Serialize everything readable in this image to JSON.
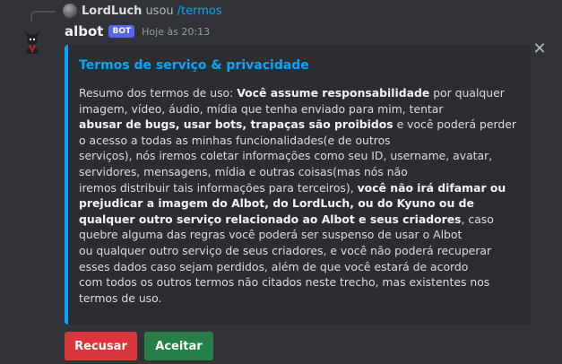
{
  "reply": {
    "author": "LordLuch",
    "verb": "usou",
    "command": "/termos"
  },
  "message": {
    "author": "albot",
    "badge": "BOT",
    "timestamp": "Hoje às 20:13"
  },
  "embed": {
    "color": "#00a8fc",
    "title": "Termos de serviço & privacidade",
    "segments": [
      {
        "text": "Resumo dos termos de uso: ",
        "bold": false
      },
      {
        "text": "Você assume responsabilidade",
        "bold": true
      },
      {
        "text": " por qualquer imagem, vídeo, áudio, mídia que tenha enviado para mim, tentar",
        "bold": false
      },
      {
        "br": true
      },
      {
        "text": "abusar de bugs, usar bots, trapaças são proibidos",
        "bold": true
      },
      {
        "text": " e você poderá perder o acesso a todas as minhas funcionalidades(e de outros",
        "bold": false
      },
      {
        "br": true
      },
      {
        "text": "serviços), nós iremos coletar informações como seu ID, username, avatar, servidores, mensagens, mídia e outras coisas(mas nós não",
        "bold": false
      },
      {
        "br": true
      },
      {
        "text": "iremos distribuir tais informações para terceiros), ",
        "bold": false
      },
      {
        "text": "você não irá difamar ou prejudicar a imagem do Albot, do LordLuch, ou do Kyuno ou de",
        "bold": true
      },
      {
        "br": true
      },
      {
        "text": "qualquer outro serviço relacionado ao Albot e seus criadores",
        "bold": true
      },
      {
        "text": ", caso quebre alguma das regras você poderá ser suspenso de usar o Albot",
        "bold": false
      },
      {
        "br": true
      },
      {
        "text": "ou qualquer outro serviço de seus criadores, e você não poderá recuperar esses dados caso sejam perdidos, além de que você estará de acordo",
        "bold": false
      },
      {
        "br": true
      },
      {
        "text": "com todos os outros termos não citados neste trecho, mas existentes nos termos de uso.",
        "bold": false
      }
    ]
  },
  "icons": {
    "close": "close-icon",
    "avatar": "albot-avatar",
    "reply_avatar": "lordluch-avatar"
  },
  "buttons": {
    "decline_label": "Recusar",
    "accept_label": "Aceitar",
    "decline_color": "#da373c",
    "accept_color": "#248046"
  }
}
